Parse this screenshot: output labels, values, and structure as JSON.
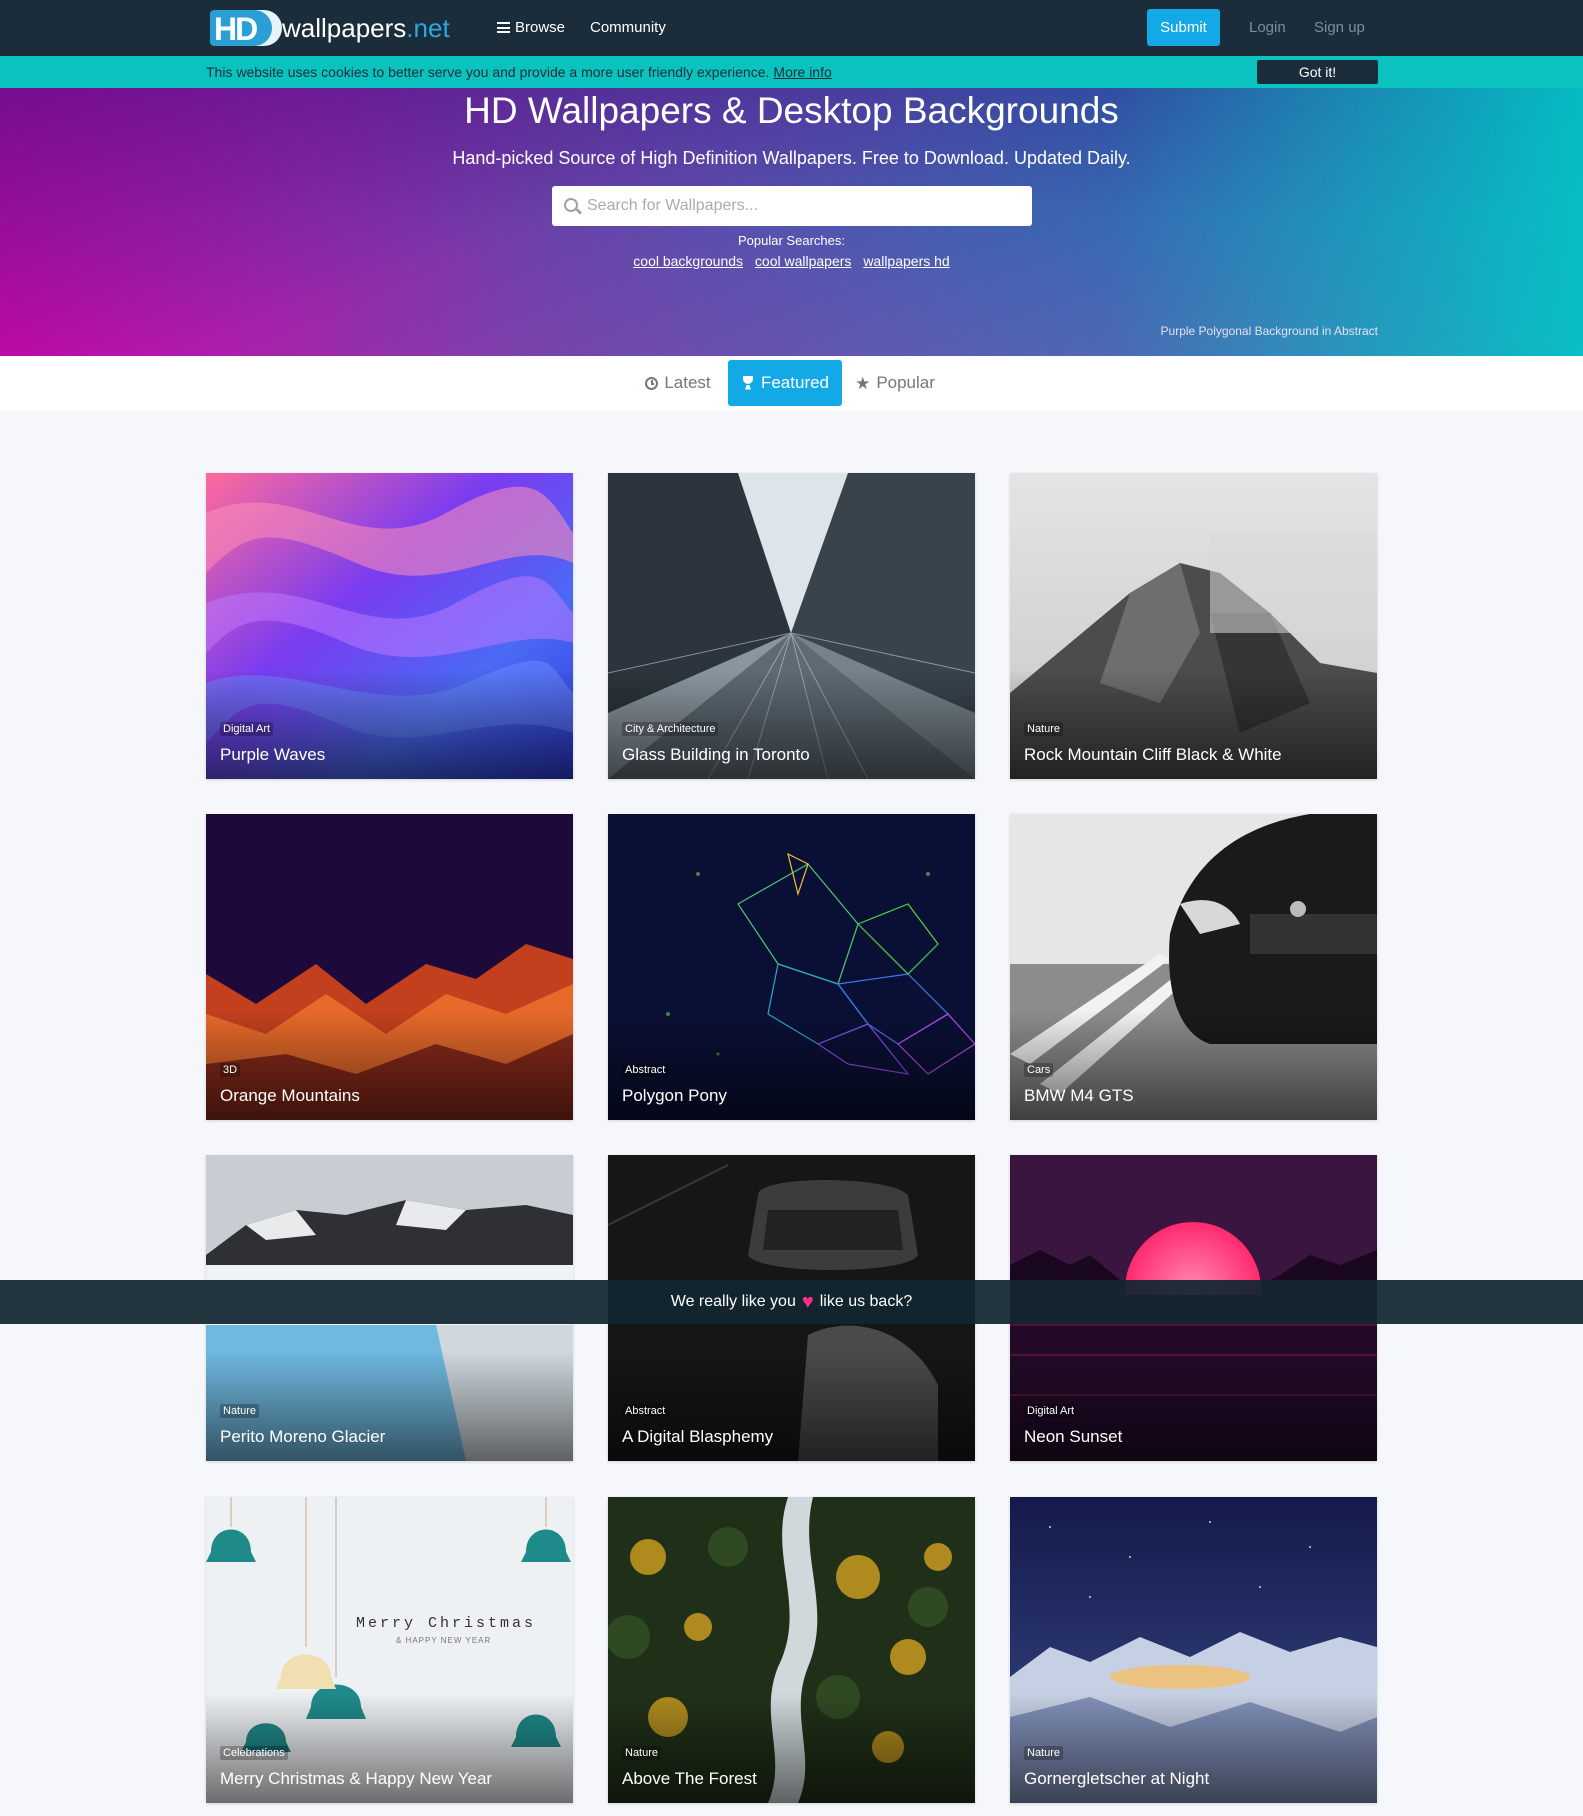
{
  "nav": {
    "logo_text": "wallpapers",
    "logo_tld": ".net",
    "logo_mark": "HD",
    "browse": "Browse",
    "community": "Community",
    "submit": "Submit",
    "login": "Login",
    "signup": "Sign up"
  },
  "cookie": {
    "text": "This website uses cookies to better serve you and provide a more user friendly experience.",
    "link": "More info",
    "button": "Got it!"
  },
  "hero": {
    "title": "HD Wallpapers & Desktop Backgrounds",
    "subtitle": "Hand-picked Source of High Definition Wallpapers. Free to Download. Updated Daily.",
    "search_placeholder": "Search for Wallpapers...",
    "popular_label": "Popular Searches:",
    "popular": [
      "cool backgrounds",
      "cool wallpapers",
      "wallpapers hd"
    ],
    "caption": "Purple Polygonal Background in Abstract"
  },
  "tabs": [
    {
      "label": "Latest",
      "icon": "clock-icon",
      "active": false
    },
    {
      "label": "Featured",
      "icon": "trophy-icon",
      "active": true
    },
    {
      "label": "Popular",
      "icon": "star-icon",
      "active": false
    }
  ],
  "cards": [
    {
      "category": "Digital Art",
      "title": "Purple Waves"
    },
    {
      "category": "City & Architecture",
      "title": "Glass Building in Toronto"
    },
    {
      "category": "Nature",
      "title": "Rock Mountain Cliff Black & White"
    },
    {
      "category": "3D",
      "title": "Orange Mountains"
    },
    {
      "category": "Abstract",
      "title": "Polygon Pony"
    },
    {
      "category": "Cars",
      "title": "BMW M4 GTS"
    },
    {
      "category": "Nature",
      "title": "Perito Moreno Glacier"
    },
    {
      "category": "Abstract",
      "title": "A Digital Blasphemy"
    },
    {
      "category": "Digital Art",
      "title": "Neon Sunset"
    },
    {
      "category": "Celebrations",
      "title": "Merry Christmas & Happy New Year"
    },
    {
      "category": "Nature",
      "title": "Above The Forest"
    },
    {
      "category": "Nature",
      "title": "Gornergletscher at Night"
    }
  ],
  "christmas_text": {
    "line1": "Merry Christmas",
    "line2": "& HAPPY NEW YEAR"
  },
  "like_bar": {
    "before": "We really like you",
    "after": "like us back?"
  },
  "colors": {
    "navbar": "#1b2d3a",
    "accent": "#13a9e6",
    "cookie_bar": "#0bc3be",
    "heart": "#ff2f8e"
  }
}
